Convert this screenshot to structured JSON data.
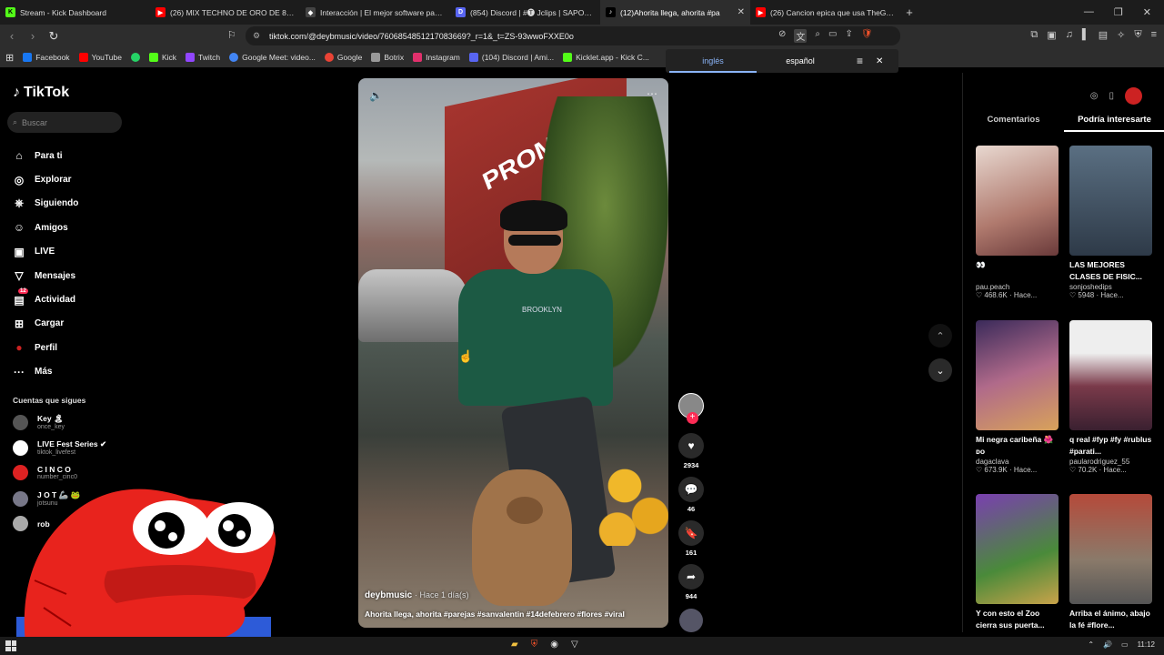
{
  "browser": {
    "tabs": [
      {
        "label": "Stream - Kick Dashboard",
        "color": "#53fc18",
        "glyph": "K"
      },
      {
        "label": "(26) MIX TECHNO DE ORO DE 80's &",
        "color": "#ff0000",
        "glyph": "▶"
      },
      {
        "label": "Interacción | El mejor software para p",
        "color": "#444444",
        "glyph": "◆"
      },
      {
        "label": "(854) Discord | #🅣 Jclips | SAPOLIC",
        "color": "#5865f2",
        "glyph": "D"
      },
      {
        "label": "(12)Ahorita llega, ahorita #pa",
        "color": "#000000",
        "glyph": "♪",
        "active": true
      },
      {
        "label": "(26) Cancion epica que usa TheGrefg",
        "color": "#ff0000",
        "glyph": "▶"
      }
    ],
    "url": "tiktok.com/@deybmusic/video/7606854851217083669?_r=1&_t=ZS-93wwoFXXE0o",
    "bookmarks": [
      {
        "label": "Facebook",
        "color": "#1877f2"
      },
      {
        "label": "YouTube",
        "color": "#ff0000"
      },
      {
        "label": "",
        "color": "#25d366"
      },
      {
        "label": "Kick",
        "color": "#53fc18"
      },
      {
        "label": "Twitch",
        "color": "#9146ff"
      },
      {
        "label": "Google Meet: video...",
        "color": "#00832d"
      },
      {
        "label": "Google",
        "color": "#4285f4"
      },
      {
        "label": "Botrix",
        "color": "#999999"
      },
      {
        "label": "Instagram",
        "color": "#e1306c"
      },
      {
        "label": "(104) Discord | Ami...",
        "color": "#5865f2"
      },
      {
        "label": "Kicklet.app - Kick C...",
        "color": "#53fc18"
      }
    ],
    "translate": {
      "lang_a": "inglés",
      "lang_b": "español"
    }
  },
  "tiktok": {
    "logo": "TikTok",
    "search_placeholder": "Buscar",
    "nav": [
      {
        "label": "Para ti",
        "icon": "⌂"
      },
      {
        "label": "Explorar",
        "icon": "◎"
      },
      {
        "label": "Siguiendo",
        "icon": "⎈"
      },
      {
        "label": "Amigos",
        "icon": "☺"
      },
      {
        "label": "LIVE",
        "icon": "▣"
      },
      {
        "label": "Mensajes",
        "icon": "▽"
      },
      {
        "label": "Actividad",
        "icon": "▤",
        "badge": "12"
      },
      {
        "label": "Cargar",
        "icon": "⊞"
      },
      {
        "label": "Perfil",
        "icon": "●"
      },
      {
        "label": "Más",
        "icon": "···"
      }
    ],
    "following_header": "Cuentas que sigues",
    "following": [
      {
        "name": "Key 🏝",
        "handle": "once_key"
      },
      {
        "name": "LIVE Fest Series ✔",
        "handle": "tiktok_livefest"
      },
      {
        "name": "C I N C O",
        "handle": "number_cinc0"
      },
      {
        "name": "J O T 🦾 🐸",
        "handle": "jotsunu"
      },
      {
        "name": "rob",
        "handle": ""
      }
    ],
    "video": {
      "author": "deybmusic",
      "time": "· Hace 1 día(s)",
      "caption": "Ahorita llega, ahorita #parejas #sanvalentin #14defebrero #flores #viral",
      "shirt_text": "BROOKLYN",
      "sign_text": "PROMA"
    },
    "actions": {
      "likes": "2934",
      "comments": "46",
      "saves": "161",
      "shares": "944"
    },
    "right": {
      "tab_comments": "Comentarios",
      "tab_interest": "Podría interesarte",
      "cards": [
        {
          "title": "👀",
          "author": "pau.peach",
          "likes": "♡ 468.6K",
          "time": "· Hace...",
          "thumb": "#c9a99c"
        },
        {
          "title": "LAS MEJORES CLASES DE FISIC...",
          "author": "sonjoshedips",
          "likes": "♡ 5948",
          "time": "· Hace...",
          "thumb": "#4a5f73"
        },
        {
          "title": "Mi negra caribeña 🌺 ᴅᴏ",
          "author": "dagaclava",
          "likes": "♡ 673.9K",
          "time": "· Hace...",
          "thumb": "#8c5a7a"
        },
        {
          "title": "q real #fyp #fy #rublus #parati...",
          "author": "paularodriguez_55",
          "likes": "♡ 70.2K",
          "time": "· Hace...",
          "thumb": "#6b3f4f"
        },
        {
          "title": "Y con esto el Zoo cierra sus puerta...",
          "author": "",
          "likes": "",
          "time": "",
          "thumb": "#5b8a3c"
        },
        {
          "title": "Arriba el ánimo, abajo la fé #flore...",
          "author": "",
          "likes": "",
          "time": "",
          "thumb": "#8a5a4c"
        }
      ]
    }
  },
  "taskbar": {
    "time": "11:12"
  },
  "colors": {
    "accent": "#fe2c55",
    "link": "#8ab4f8"
  }
}
